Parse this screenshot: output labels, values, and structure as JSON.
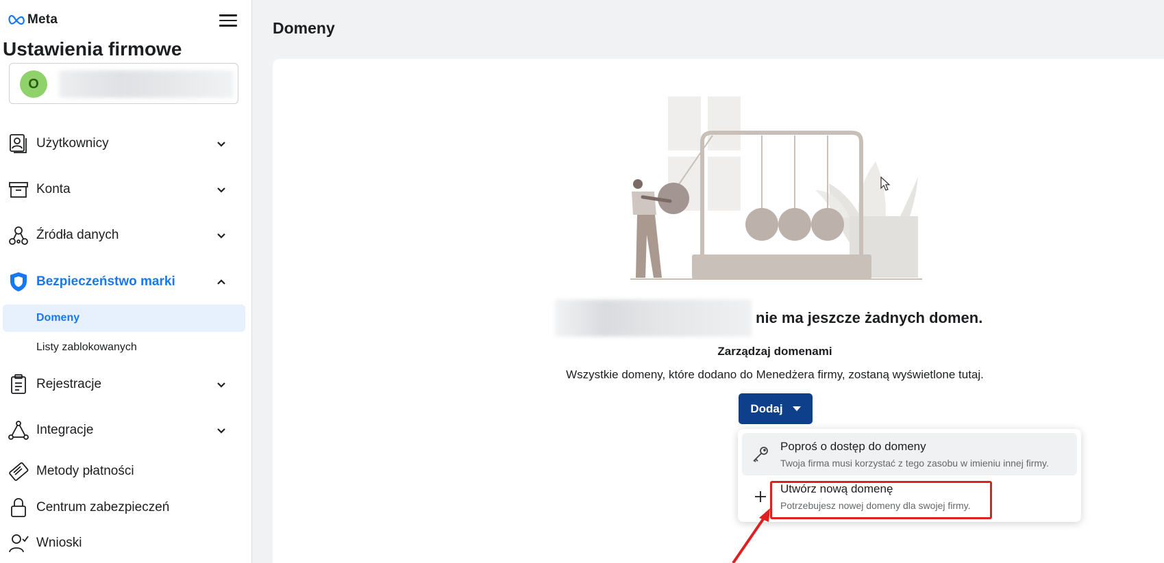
{
  "brand": {
    "logo_text": "Meta"
  },
  "sidebar": {
    "title": "Ustawienia firmowe",
    "account": {
      "avatar_letter": "O"
    },
    "items": [
      {
        "label": "Użytkownicy",
        "icon": "users-icon",
        "expandable": true
      },
      {
        "label": "Konta",
        "icon": "archive-box-icon",
        "expandable": true
      },
      {
        "label": "Źródła danych",
        "icon": "data-sources-icon",
        "expandable": true
      },
      {
        "label": "Bezpieczeństwo marki",
        "icon": "shield-icon",
        "expandable": true,
        "expanded": true
      },
      {
        "label": "Rejestracje",
        "icon": "clipboard-icon",
        "expandable": true
      },
      {
        "label": "Integracje",
        "icon": "integrations-icon",
        "expandable": true
      },
      {
        "label": "Metody płatności",
        "icon": "credit-card-icon",
        "expandable": false
      },
      {
        "label": "Centrum zabezpieczeń",
        "icon": "lock-icon",
        "expandable": false
      },
      {
        "label": "Wnioski",
        "icon": "person-check-icon",
        "expandable": false
      }
    ],
    "brand_safety_subitems": [
      {
        "label": "Domeny",
        "selected": true
      },
      {
        "label": "Listy zablokowanych",
        "selected": false
      }
    ]
  },
  "main": {
    "page_title": "Domeny",
    "empty_state": {
      "heading": "nie ma jeszcze żadnych domen.",
      "subheading": "Zarządzaj domenami",
      "description": "Wszystkie domeny, które dodano do Menedżera firmy, zostaną wyświetlone tutaj."
    },
    "add_button": {
      "label": "Dodaj"
    },
    "dropdown": [
      {
        "title": "Poproś o dostęp do domeny",
        "description": "Twoja firma musi korzystać z tego zasobu w imieniu innej firmy.",
        "icon": "key-icon"
      },
      {
        "title": "Utwórz nową domenę",
        "description": "Potrzebujesz nowej domeny dla swojej firmy.",
        "icon": "plus-icon"
      }
    ]
  },
  "colors": {
    "accent": "#1877f2",
    "primary_button": "#0e3f8a",
    "selected_bg": "#e7f0fd",
    "highlight": "#e02020",
    "avatar": "#8fd16a"
  }
}
